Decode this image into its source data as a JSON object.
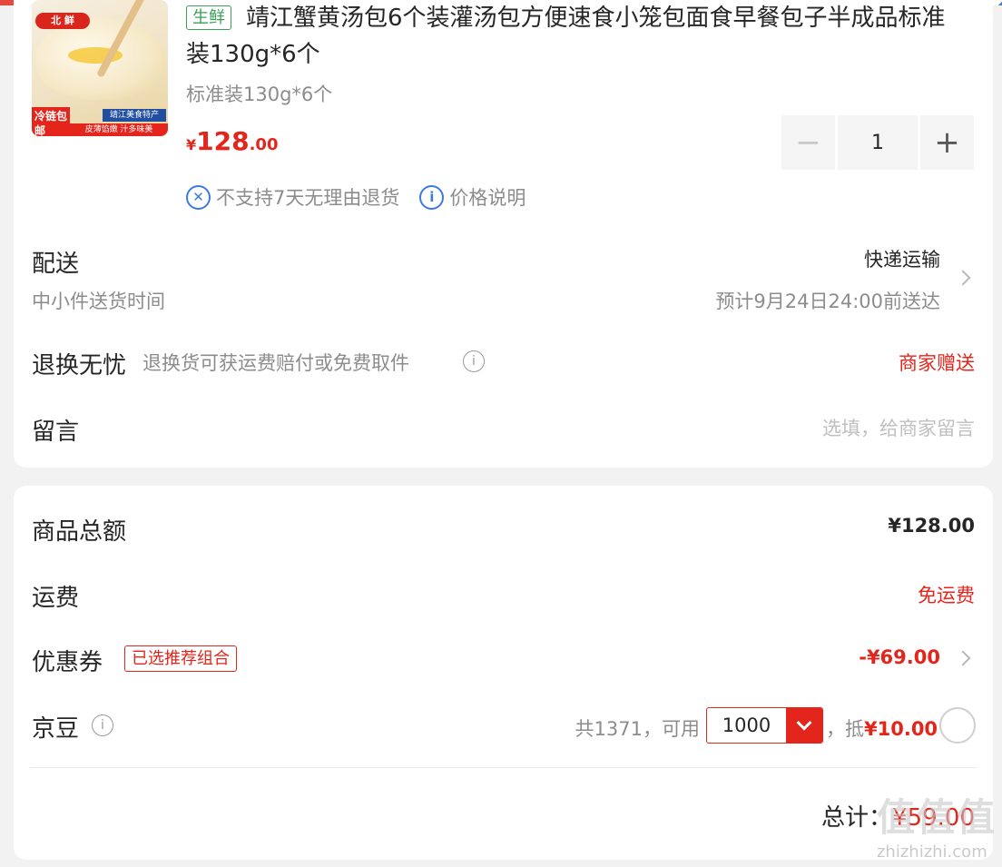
{
  "product": {
    "image_badges": {
      "brand": "北 鲜",
      "cold_chain": "冷链包邮",
      "origin": "靖江美食特产",
      "slogan": "皮薄馅嫩 汁多味美"
    },
    "tag": "生鲜",
    "title": "靖江蟹黄汤包6个装灌汤包方便速食小笼包面食早餐包子半成品标准装130g*6个",
    "spec": "标准装130g*6个",
    "price": {
      "currency": "¥",
      "integer": "128",
      "decimal": ".00"
    },
    "quantity": {
      "minus": "−",
      "value": "1",
      "plus": "+"
    },
    "policies": [
      {
        "icon": "no-return-icon",
        "text": "不支持7天无理由退货"
      },
      {
        "icon": "info-circle-icon",
        "text": "价格说明"
      }
    ]
  },
  "delivery": {
    "label": "配送",
    "sub": "中小件送货时间",
    "method": "快递运输",
    "eta": "预计9月24日24:00前送达"
  },
  "return_worry_free": {
    "label": "退换无忧",
    "desc": "退换货可获运费赔付或免费取件",
    "value": "商家赠送"
  },
  "message": {
    "label": "留言",
    "placeholder": "选填，给商家留言"
  },
  "summary": {
    "goods_total": {
      "label": "商品总额",
      "value": "¥128.00"
    },
    "shipping": {
      "label": "运费",
      "value": "免运费"
    },
    "coupon": {
      "label": "优惠券",
      "badge": "已选推荐组合",
      "value": "-¥69.00"
    },
    "jingdou": {
      "label": "京豆",
      "total_prefix": "共1371，可用",
      "selected": "1000",
      "deduct_prefix": "，抵",
      "deduct_value": "¥10.00"
    },
    "total": {
      "label": "总计：",
      "value": "¥59.00"
    }
  },
  "watermark": {
    "big": "值值值",
    "small": "zhizhizhi.com"
  },
  "colors": {
    "accent": "#e3251c",
    "fresh": "#3aa157",
    "info": "#3b7be0",
    "muted": "#8c8c8c"
  }
}
